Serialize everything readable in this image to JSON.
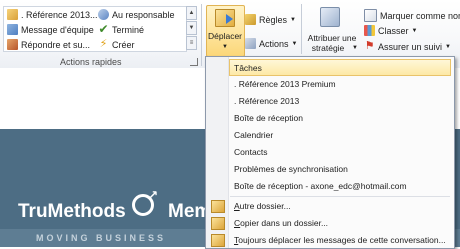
{
  "ribbon": {
    "quick_steps": {
      "col1": [
        {
          "label": ". Référence 2013...",
          "icon": "folder-arrow-icon"
        },
        {
          "label": "Message d'équipe",
          "icon": "team-message-icon"
        },
        {
          "label": "Répondre et su...",
          "icon": "reply-delete-icon"
        }
      ],
      "col2": [
        {
          "label": "Au responsable",
          "icon": "forward-manager-icon"
        },
        {
          "label": "Terminé",
          "icon": "checkmark-icon"
        },
        {
          "label": "Créer",
          "icon": "lightning-icon"
        }
      ],
      "group_label": "Actions rapides"
    },
    "move_group": {
      "deplacer_label": "Déplacer",
      "regles_label": "Règles",
      "actions_label": "Actions"
    },
    "tags_group": {
      "strategy_label_1": "Attribuer une",
      "strategy_label_2": "stratégie",
      "unread_label": "Marquer comme non lu",
      "categorize_label": "Classer",
      "followup_label": "Assurer un suivi"
    }
  },
  "banner": {
    "logo_part1": "TruMethods",
    "logo_part2": "Mem",
    "tagline": "MOVING BUSINESS"
  },
  "menu": {
    "items": [
      {
        "label": "Tâches",
        "highlighted": true
      },
      {
        "label": ". Référence 2013 Premium"
      },
      {
        "label": ". Référence 2013"
      },
      {
        "label": "Boîte de réception"
      },
      {
        "label": "Calendrier"
      },
      {
        "label": "Contacts"
      },
      {
        "label": "Problèmes de synchronisation"
      },
      {
        "label": "Boîte de réception - axone_edc@hotmail.com"
      }
    ],
    "actions": [
      {
        "label": "Autre dossier...",
        "underline": "A",
        "rest": "utre dossier...",
        "icon": "other-folder-icon"
      },
      {
        "label": "Copier dans un dossier...",
        "underline": "C",
        "rest": "opier dans un dossier...",
        "icon": "copy-folder-icon"
      },
      {
        "label": "Toujours déplacer les messages de cette conversation...",
        "underline": "T",
        "rest": "oujours déplacer les messages de cette conversation...",
        "icon": "always-move-icon"
      }
    ]
  }
}
